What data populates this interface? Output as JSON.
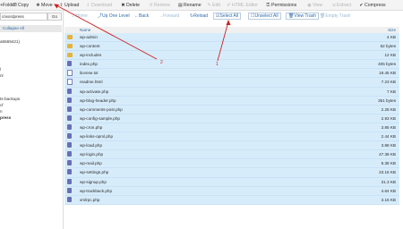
{
  "toolbar": {
    "items": [
      {
        "label": "+Folder",
        "icon": "folder-plus-icon",
        "disabled": false
      },
      {
        "label": "Copy",
        "icon": "copy-icon",
        "disabled": false
      },
      {
        "label": "Move",
        "icon": "move-icon",
        "disabled": false
      },
      {
        "label": "Upload",
        "icon": "upload-icon",
        "disabled": false
      },
      {
        "label": "Download",
        "icon": "download-icon",
        "disabled": true
      },
      {
        "label": "Delete",
        "icon": "delete-icon",
        "disabled": false
      },
      {
        "label": "Restore",
        "icon": "restore-icon",
        "disabled": true
      },
      {
        "label": "Rename",
        "icon": "rename-icon",
        "disabled": false
      },
      {
        "label": "Edit",
        "icon": "edit-icon",
        "disabled": true
      },
      {
        "label": "HTML Editor",
        "icon": "html-editor-icon",
        "disabled": true
      },
      {
        "label": "Permissions",
        "icon": "key-icon",
        "disabled": false
      },
      {
        "label": "View",
        "icon": "eye-icon",
        "disabled": true
      },
      {
        "label": "Extract",
        "icon": "extract-icon",
        "disabled": true
      },
      {
        "label": "Compress",
        "icon": "compress-icon",
        "disabled": false
      }
    ]
  },
  "sidebar": {
    "path_value": "c/wordpress",
    "go_label": "Go",
    "collapse_label": "Collapse All",
    "tree": [
      {
        "label": "a5569421)",
        "bold": false
      },
      {
        "label": "l",
        "bold": false
      },
      {
        "label": "nl",
        "bold": false
      },
      {
        "label": "ts-backups",
        "bold": false
      },
      {
        "label": "cf",
        "bold": false
      },
      {
        "label": "n",
        "bold": false
      },
      {
        "label": "press",
        "bold": true
      }
    ]
  },
  "navbar": {
    "items": [
      {
        "label": "Home",
        "icon": "home-icon",
        "disabled": true
      },
      {
        "label": "Up One Level",
        "icon": "level-up-icon",
        "disabled": false
      },
      {
        "label": "Back",
        "icon": "back-arrow-icon",
        "disabled": false
      },
      {
        "label": "Forward",
        "icon": "forward-arrow-icon",
        "disabled": true
      },
      {
        "label": "Reload",
        "icon": "reload-icon",
        "disabled": false
      },
      {
        "label": "Select All",
        "icon": "checkbox-icon",
        "disabled": false
      },
      {
        "label": "Unselect All",
        "icon": "checkbox-empty-icon",
        "disabled": false
      },
      {
        "label": "View Trash",
        "icon": "trash-icon",
        "disabled": false
      },
      {
        "label": "Empty Trash",
        "icon": "empty-trash-icon",
        "disabled": true
      }
    ]
  },
  "table": {
    "headers": {
      "name": "Name",
      "size": "Size"
    },
    "rows": [
      {
        "name": "wp-admin",
        "size": "4 KB",
        "type": "folder"
      },
      {
        "name": "wp-content",
        "size": "52 bytes",
        "type": "folder"
      },
      {
        "name": "wp-includes",
        "size": "12 KB",
        "type": "folder"
      },
      {
        "name": "index.php",
        "size": "405 bytes",
        "type": "php"
      },
      {
        "name": "license.txt",
        "size": "19.45 KB",
        "type": "doc"
      },
      {
        "name": "readme.html",
        "size": "7.23 KB",
        "type": "doc"
      },
      {
        "name": "wp-activate.php",
        "size": "7 KB",
        "type": "php"
      },
      {
        "name": "wp-blog-header.php",
        "size": "351 bytes",
        "type": "php"
      },
      {
        "name": "wp-comments-post.php",
        "size": "2.28 KB",
        "type": "php"
      },
      {
        "name": "wp-config-sample.php",
        "size": "2.93 KB",
        "type": "php"
      },
      {
        "name": "wp-cron.php",
        "size": "3.85 KB",
        "type": "php"
      },
      {
        "name": "wp-links-opml.php",
        "size": "2.44 KB",
        "type": "php"
      },
      {
        "name": "wp-load.php",
        "size": "3.88 KB",
        "type": "php"
      },
      {
        "name": "wp-login.php",
        "size": "47.38 KB",
        "type": "php"
      },
      {
        "name": "wp-mail.php",
        "size": "8.38 KB",
        "type": "php"
      },
      {
        "name": "wp-settings.php",
        "size": "23.15 KB",
        "type": "php"
      },
      {
        "name": "wp-signup.php",
        "size": "31.3 KB",
        "type": "php"
      },
      {
        "name": "wp-trackback.php",
        "size": "4.64 KB",
        "type": "php"
      },
      {
        "name": "xmlrpc.php",
        "size": "3.16 KB",
        "type": "php"
      }
    ]
  },
  "annotations": {
    "label_1": "1",
    "label_2": "2",
    "color": "#cc2222"
  }
}
